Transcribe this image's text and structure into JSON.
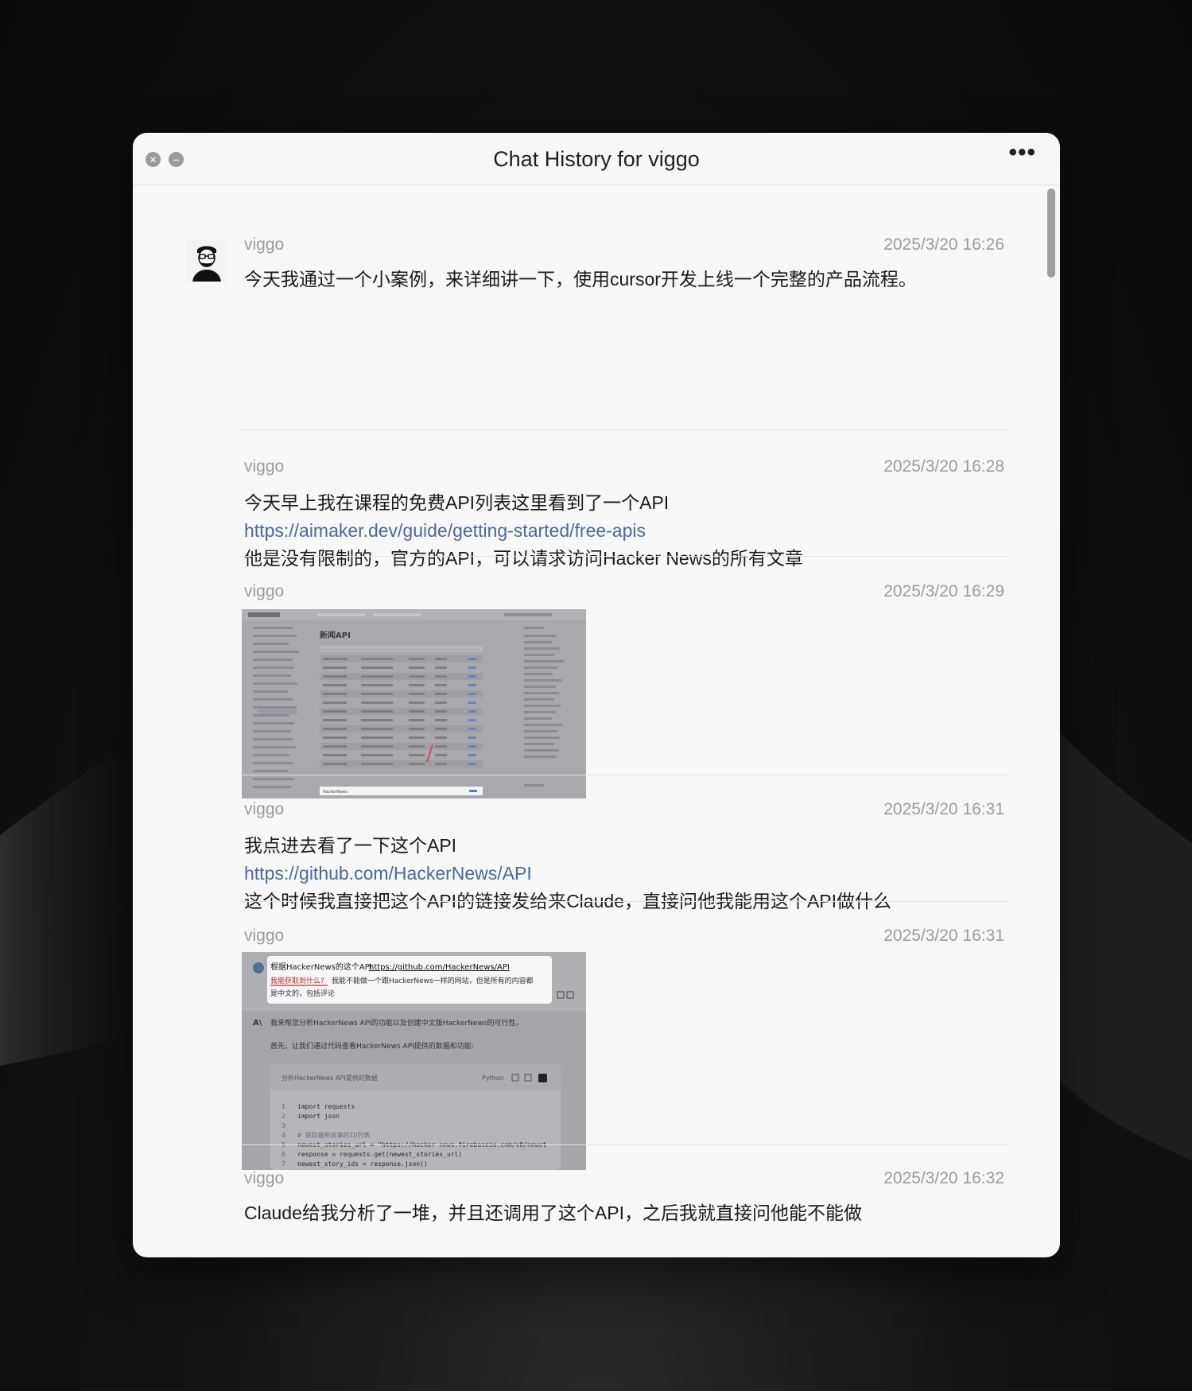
{
  "window": {
    "title": "Chat History for viggo",
    "more_label": "•••"
  },
  "messages": [
    {
      "user": "viggo",
      "time": "2025/3/20 16:26",
      "lines": [
        "今天我通过一个小案例，来详细讲一下，使用cursor开发上线一个完整的产品流程。"
      ]
    },
    {
      "user": "viggo",
      "time": "2025/3/20 16:28",
      "line1": "今天早上我在课程的免费API列表这里看到了一个API",
      "link": "https://aimaker.dev/guide/getting-started/free-apis",
      "line2": "他是没有限制的，官方的API，可以请求访问Hacker News的所有文章"
    },
    {
      "user": "viggo",
      "time": "2025/3/20 16:29",
      "image": {
        "heading": "新闻API",
        "last_row": "HackerNews"
      }
    },
    {
      "user": "viggo",
      "time": "2025/3/20 16:31",
      "line1": "我点进去看了一下这个API",
      "link": "https://github.com/HackerNews/API",
      "line2": "这个时候我直接把这个API的链接发给来Claude，直接问他我能用这个API做什么"
    },
    {
      "user": "viggo",
      "time": "2025/3/20 16:31",
      "image": {
        "prompt_prefix": "根据HackerNews的这个API",
        "prompt_link": "https://github.com/HackerNews/API",
        "prompt_q": "我能获取到什么?",
        "prompt_rest": "我能不能做一个跟HackerNews一样的网站，但是所有的内容都",
        "prompt_rest2": "是中文的，包括评论",
        "reply1": "我来帮您分析HackerNews API的功能以及创建中文版HackerNews的可行性。",
        "reply2": "首先，让我们通过代码查看HackerNews API提供的数据和功能:",
        "code_title": "分析HackerNews API提供的数据",
        "code_lang": "Python",
        "code_lines": [
          "import requests",
          "import json",
          "",
          "# 获取最新故事的ID列表",
          "newest_stories_url = \"https://hacker-news.firebaseio.com/v0/newst",
          "response = requests.get(newest_stories_url)",
          "newest_story_ids = response.json()"
        ]
      }
    },
    {
      "user": "viggo",
      "time": "2025/3/20 16:32",
      "lines": [
        "Claude给我分析了一堆，并且还调用了这个API，之后我就直接问他能不能做"
      ]
    }
  ]
}
